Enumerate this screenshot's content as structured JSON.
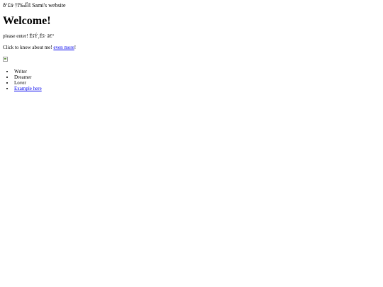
{
  "site": {
    "title": "ð‘£ä·†î‰Ëš Sami's website"
  },
  "main": {
    "heading": "Welcome!",
    "enter_text": "please enter! ËšÝ¸Ëš‧ â€“",
    "about_prefix": "Click to know about me! ",
    "about_link": "even more",
    "about_suffix": "!"
  },
  "list": {
    "items": [
      "Writer",
      "Dreamer",
      "Lover"
    ],
    "example_link": "Example here"
  }
}
